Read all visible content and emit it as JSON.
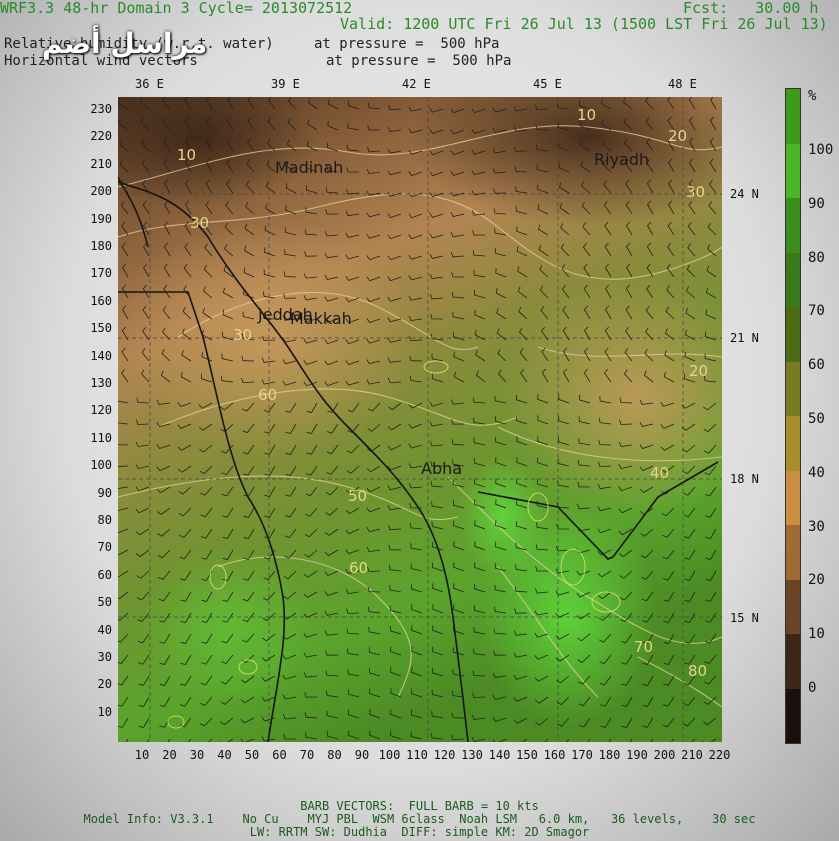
{
  "header": {
    "title_line": "WRF3.3 48-hr Domain 3 Cycle= 2013072512",
    "fcst": "Fcst:   30.00 h",
    "valid": "Valid: 1200 UTC Fri 26 Jul 13 (1500 LST Fri 26 Jul 13)",
    "field1_name": "Relative humidity (w.r.t. water)",
    "field1_level": "at pressure =  500 hPa",
    "field2_name": "Horizontal wind vectors",
    "field2_level": "at pressure =  500 hPa",
    "logo_text": "مراسل أضم"
  },
  "map": {
    "lon_labels": [
      "36 E",
      "39 E",
      "42 E",
      "45 E",
      "48 E"
    ],
    "lat_labels": [
      "24 N",
      "21 N",
      "18 N",
      "15 N"
    ],
    "y_ticks": [
      "230",
      "220",
      "210",
      "200",
      "190",
      "180",
      "170",
      "160",
      "150",
      "140",
      "130",
      "120",
      "110",
      "100",
      "90",
      "80",
      "70",
      "60",
      "50",
      "40",
      "30",
      "20",
      "10"
    ],
    "x_ticks": [
      "10",
      "20",
      "30",
      "40",
      "50",
      "60",
      "70",
      "80",
      "90",
      "100",
      "110",
      "120",
      "130",
      "140",
      "150",
      "160",
      "170",
      "180",
      "190",
      "200",
      "210",
      "220"
    ],
    "cities": [
      "Madinah",
      "Jeddah",
      "Makkah",
      "Riyadh",
      "Abha"
    ],
    "contour_values": [
      "10",
      "10",
      "20",
      "30",
      "30",
      "30",
      "20",
      "60",
      "40",
      "50",
      "60",
      "70",
      "80"
    ],
    "colors": {
      "dry": "#6b4a2a",
      "mid": "#b8884e",
      "moist": "#7a9a3a",
      "wet": "#4fb82f"
    }
  },
  "colorbar": {
    "unit": "%",
    "labels": [
      "100",
      "90",
      "80",
      "70",
      "60",
      "50",
      "40",
      "30",
      "20",
      "10",
      "0"
    ],
    "colors": [
      "#3c9b1d",
      "#49b626",
      "#3a8f1c",
      "#3b7a1a",
      "#4d6a15",
      "#7a7a22",
      "#a88d2a",
      "#c98e3f",
      "#a06a35",
      "#6a4425",
      "#3c2617",
      "#1a0f0a"
    ]
  },
  "footer": {
    "line1": "BARB VECTORS:  FULL BARB = 10 kts",
    "line2": "Model Info: V3.3.1    No Cu    MYJ PBL  WSM 6class  Noah LSM   6.0 km,   36 levels,    30 sec",
    "line3": "LW: RRTM SW: Dudhia  DIFF: simple KM: 2D Smagor"
  }
}
